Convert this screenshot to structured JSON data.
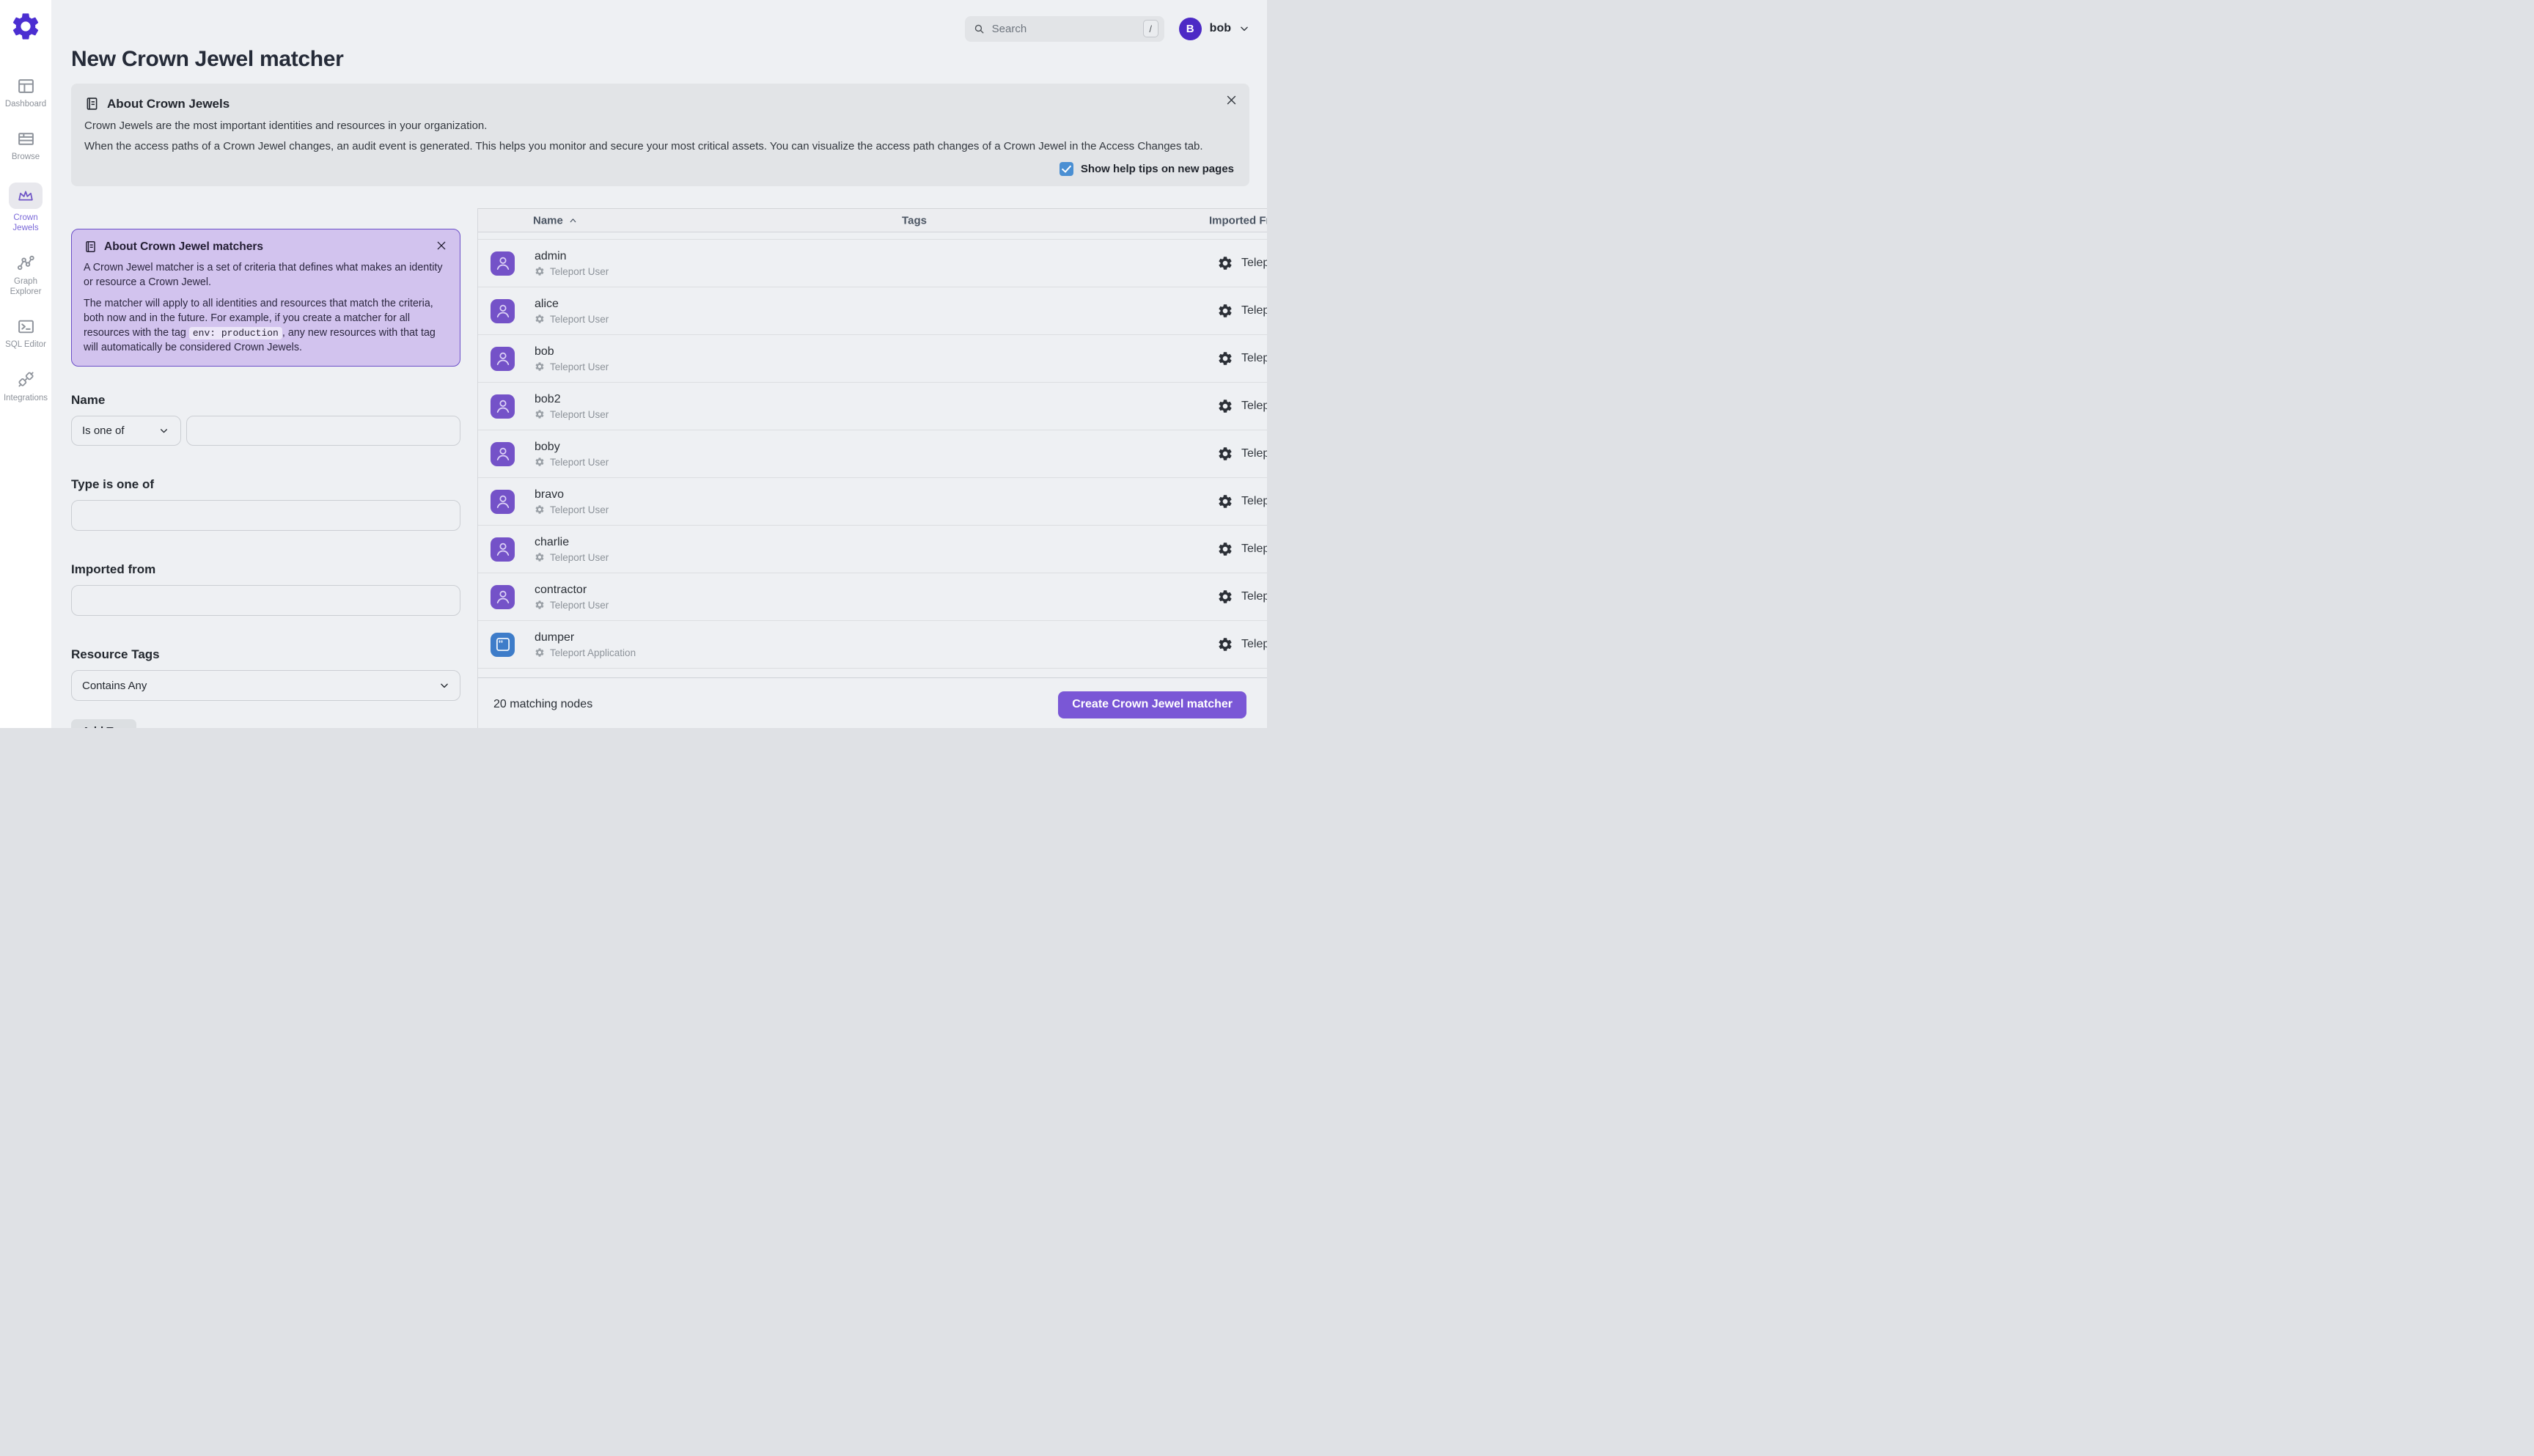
{
  "app": {
    "title": "New Crown Jewel matcher"
  },
  "sidebar": {
    "logo_icon": "gear-logo-icon",
    "items": [
      {
        "label": "Dashboard",
        "icon": "dashboard-icon",
        "active": false
      },
      {
        "label": "Browse",
        "icon": "browse-icon",
        "active": false
      },
      {
        "label": "Crown Jewels",
        "label_line1": "Crown",
        "label_line2": "Jewels",
        "icon": "crown-icon",
        "active": true
      },
      {
        "label": "Graph Explorer",
        "label_line1": "Graph",
        "label_line2": "Explorer",
        "icon": "graph-icon",
        "active": false
      },
      {
        "label": "SQL Editor",
        "icon": "terminal-icon",
        "active": false
      },
      {
        "label": "Integrations",
        "icon": "plug-icon",
        "active": false
      }
    ]
  },
  "topbar": {
    "search_placeholder": "Search",
    "search_shortcut": "/",
    "user_initial": "B",
    "user_name": "bob"
  },
  "banner": {
    "icon": "book-icon",
    "title": "About Crown Jewels",
    "p1": "Crown Jewels are the most important identities and resources in your organization.",
    "p2": "When the access paths of a Crown Jewel changes, an audit event is generated. This helps you monitor and secure your most critical assets. You can visualize the access path changes of a Crown Jewel in the Access Changes tab.",
    "checkbox_label": "Show help tips on new pages",
    "checkbox_checked": true
  },
  "matcher_info": {
    "icon": "book-icon",
    "title": "About Crown Jewel matchers",
    "p1": "A Crown Jewel matcher is a set of criteria that defines what makes an identity or resource a Crown Jewel.",
    "p2_pre": "The matcher will apply to all identities and resources that match the criteria, both now and in the future. For example, if you create a matcher for all resources with the tag ",
    "p2_code": "env: production",
    "p2_post": ", any new resources with that tag will automatically be considered Crown Jewels."
  },
  "form": {
    "name_label": "Name",
    "name_operator": "Is one of",
    "name_value": "",
    "type_label": "Type is one of",
    "type_value": "",
    "imported_label": "Imported from",
    "imported_value": "",
    "tags_label": "Resource Tags",
    "tags_operator": "Contains Any",
    "add_tag_label": "Add Tag"
  },
  "table": {
    "columns": {
      "name": "Name",
      "tags": "Tags",
      "imported_from": "Imported From"
    },
    "sort": {
      "column": "Name",
      "direction": "asc"
    },
    "rows": [
      {
        "name": "admin",
        "type": "Teleport User",
        "kind": "user",
        "imported_from": "Teleport"
      },
      {
        "name": "alice",
        "type": "Teleport User",
        "kind": "user",
        "imported_from": "Teleport"
      },
      {
        "name": "bob",
        "type": "Teleport User",
        "kind": "user",
        "imported_from": "Teleport"
      },
      {
        "name": "bob2",
        "type": "Teleport User",
        "kind": "user",
        "imported_from": "Teleport"
      },
      {
        "name": "boby",
        "type": "Teleport User",
        "kind": "user",
        "imported_from": "Teleport"
      },
      {
        "name": "bravo",
        "type": "Teleport User",
        "kind": "user",
        "imported_from": "Teleport"
      },
      {
        "name": "charlie",
        "type": "Teleport User",
        "kind": "user",
        "imported_from": "Teleport"
      },
      {
        "name": "contractor",
        "type": "Teleport User",
        "kind": "user",
        "imported_from": "Teleport"
      },
      {
        "name": "dumper",
        "type": "Teleport Application",
        "kind": "app",
        "imported_from": "Teleport"
      }
    ]
  },
  "footer": {
    "count_text": "20 matching nodes",
    "create_label": "Create Crown Jewel matcher"
  },
  "colors": {
    "accent_purple": "#7a57d6",
    "logo_purple": "#4b2ed1",
    "avatar_purple": "#7452c8",
    "user_circle_purple": "#4c2ac5",
    "app_blue": "#3d7cc9",
    "info_box_bg": "#d2c3ee",
    "info_box_border": "#6b4fc8",
    "checkbox_blue": "#4a8fd3",
    "page_bg": "#eef0f3",
    "banner_bg": "#e2e4e7"
  }
}
